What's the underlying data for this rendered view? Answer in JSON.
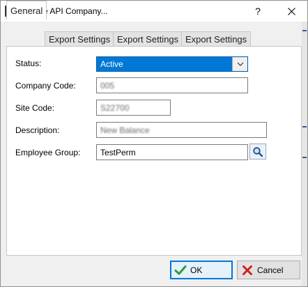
{
  "window": {
    "title": "Update API Company...",
    "help_label": "?",
    "icons": {
      "app": "app-icon",
      "close": "close-icon",
      "help": "help-icon"
    }
  },
  "tabs": [
    {
      "label": "General",
      "active": true
    },
    {
      "label": "Export Settings",
      "active": false
    },
    {
      "label": "Export Settings",
      "active": false
    },
    {
      "label": "Export Settings",
      "active": false
    }
  ],
  "form": {
    "status": {
      "label": "Status:",
      "value": "Active"
    },
    "company_code": {
      "label": "Company Code:",
      "value": "005"
    },
    "site_code": {
      "label": "Site Code:",
      "value": "S22700"
    },
    "description": {
      "label": "Description:",
      "value": "New Balance"
    },
    "employee_group": {
      "label": "Employee Group:",
      "value": "TestPerm",
      "lookup_icon": "search-icon"
    }
  },
  "buttons": {
    "ok": {
      "label": "OK",
      "icon": "checkmark-icon"
    },
    "cancel": {
      "label": "Cancel",
      "icon": "x-icon"
    }
  },
  "colors": {
    "accent": "#0078d7",
    "ok_check": "#2e9c3e",
    "cancel_x": "#d02020"
  }
}
